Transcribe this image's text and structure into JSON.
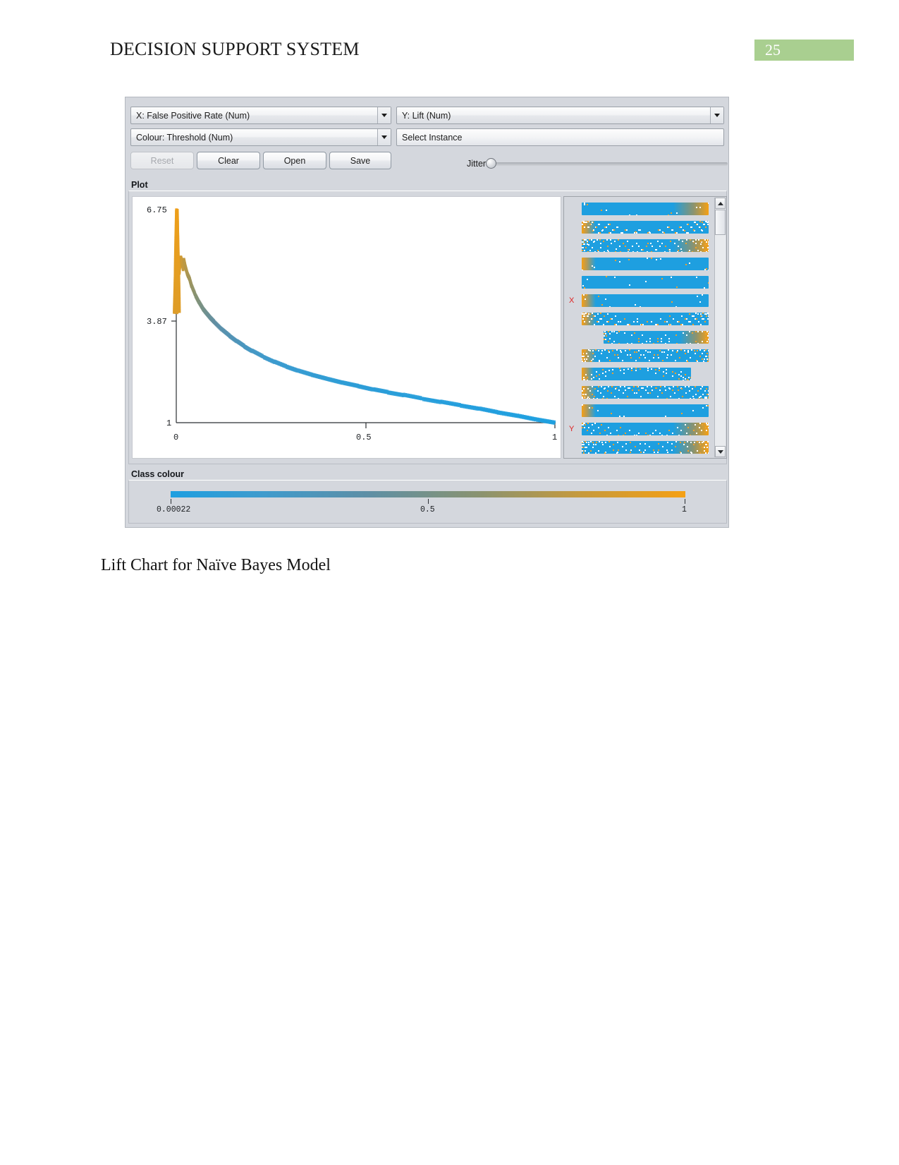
{
  "document": {
    "header_title": "DECISION SUPPORT SYSTEM",
    "page_number": "25",
    "header_accent_color": "#a9cf90",
    "caption": "Lift Chart for Naïve Bayes Model"
  },
  "app": {
    "controls": {
      "x_axis_selector": "X: False Positive Rate (Num)",
      "y_axis_selector": "Y: Lift (Num)",
      "colour_selector": "Colour: Threshold (Num)",
      "instance_selector": "Select Instance",
      "buttons": [
        {
          "label": "Reset",
          "enabled": false
        },
        {
          "label": "Clear",
          "enabled": true
        },
        {
          "label": "Open",
          "enabled": true
        },
        {
          "label": "Save",
          "enabled": true
        }
      ],
      "jitter_label": "Jitter",
      "jitter_value": 0
    },
    "plot_group_label": "Plot",
    "class_colour_group_label": "Class colour",
    "class_colour_legend": {
      "min_label": "0.00022",
      "mid_label": "0.5",
      "max_label": "1",
      "start_color": "#1e9fe0",
      "end_color": "#f5a014"
    },
    "attribute_panel": {
      "x_marker": "X",
      "y_marker": "Y",
      "x_marker_row_index": 5,
      "y_marker_row_index": 12,
      "row_count": 14,
      "rows": [
        {
          "fill_start": 0.0,
          "fill_end": 1.0,
          "density": "sparse",
          "orange_at": "right"
        },
        {
          "fill_start": 0.0,
          "fill_end": 1.0,
          "density": "dense",
          "orange_at": "left"
        },
        {
          "fill_start": 0.0,
          "fill_end": 1.0,
          "density": "dense",
          "orange_at": "right"
        },
        {
          "fill_start": 0.0,
          "fill_end": 1.0,
          "density": "sparse",
          "orange_at": "left"
        },
        {
          "fill_start": 0.0,
          "fill_end": 1.0,
          "density": "sparse",
          "orange_at": "none"
        },
        {
          "fill_start": 0.0,
          "fill_end": 1.0,
          "density": "sparse",
          "orange_at": "left"
        },
        {
          "fill_start": 0.0,
          "fill_end": 1.0,
          "density": "dense",
          "orange_at": "left"
        },
        {
          "fill_start": 0.17,
          "fill_end": 1.0,
          "density": "medium",
          "orange_at": "right"
        },
        {
          "fill_start": 0.0,
          "fill_end": 1.0,
          "density": "dense",
          "orange_at": "left"
        },
        {
          "fill_start": 0.0,
          "fill_end": 0.86,
          "density": "medium",
          "orange_at": "left"
        },
        {
          "fill_start": 0.0,
          "fill_end": 1.0,
          "density": "dense",
          "orange_at": "left"
        },
        {
          "fill_start": 0.0,
          "fill_end": 1.0,
          "density": "sparse",
          "orange_at": "left"
        },
        {
          "fill_start": 0.0,
          "fill_end": 1.0,
          "density": "medium",
          "orange_at": "right"
        },
        {
          "fill_start": 0.0,
          "fill_end": 1.0,
          "density": "dense",
          "orange_at": "right"
        }
      ]
    },
    "scrollbar": {
      "up_arrow": "scroll-up",
      "down_arrow": "scroll-down"
    }
  },
  "chart_data": {
    "type": "scatter",
    "title": "Lift Chart for Naïve Bayes Model",
    "xlabel": "False Positive Rate",
    "ylabel": "Lift",
    "colorbar_label": "Threshold",
    "xlim": [
      0,
      1
    ],
    "ylim": [
      1,
      6.75
    ],
    "xticks": [
      0,
      0.5,
      1
    ],
    "xtick_labels": [
      "0",
      "0.5",
      "1"
    ],
    "yticks": [
      1,
      3.87,
      6.75
    ],
    "ytick_labels": [
      "1",
      "3.87",
      "6.75"
    ],
    "grid": false,
    "legend": "colorbar",
    "colorbar_range": [
      0.00022,
      1
    ],
    "series": [
      {
        "name": "Lift vs False Positive Rate",
        "x": [
          0.0,
          0.001,
          0.002,
          0.003,
          0.004,
          0.005,
          0.006,
          0.007,
          0.008,
          0.01,
          0.012,
          0.014,
          0.016,
          0.018,
          0.02,
          0.024,
          0.028,
          0.032,
          0.036,
          0.04,
          0.05,
          0.06,
          0.07,
          0.08,
          0.09,
          0.1,
          0.12,
          0.14,
          0.16,
          0.18,
          0.2,
          0.23,
          0.26,
          0.29,
          0.32,
          0.36,
          0.4,
          0.44,
          0.48,
          0.52,
          0.56,
          0.6,
          0.65,
          0.7,
          0.75,
          0.8,
          0.85,
          0.9,
          0.95,
          1.0
        ],
        "y": [
          6.75,
          6.3,
          5.95,
          5.7,
          5.5,
          5.35,
          5.22,
          5.12,
          5.05,
          5.3,
          5.45,
          5.38,
          5.25,
          5.15,
          5.4,
          5.2,
          5.05,
          4.95,
          4.85,
          4.7,
          4.45,
          4.25,
          4.08,
          3.95,
          3.83,
          3.72,
          3.52,
          3.35,
          3.2,
          3.06,
          2.94,
          2.78,
          2.64,
          2.52,
          2.41,
          2.29,
          2.18,
          2.08,
          1.99,
          1.9,
          1.82,
          1.75,
          1.65,
          1.56,
          1.47,
          1.38,
          1.28,
          1.19,
          1.09,
          1.0
        ],
        "color_values": [
          1.0,
          0.985,
          0.97,
          0.955,
          0.94,
          0.928,
          0.915,
          0.905,
          0.895,
          0.88,
          0.862,
          0.845,
          0.83,
          0.815,
          0.8,
          0.775,
          0.75,
          0.725,
          0.7,
          0.672,
          0.62,
          0.575,
          0.535,
          0.5,
          0.47,
          0.442,
          0.395,
          0.355,
          0.322,
          0.293,
          0.268,
          0.236,
          0.21,
          0.188,
          0.169,
          0.148,
          0.13,
          0.115,
          0.102,
          0.091,
          0.081,
          0.072,
          0.061,
          0.052,
          0.044,
          0.036,
          0.028,
          0.02,
          0.01,
          0.00022
        ]
      }
    ]
  }
}
